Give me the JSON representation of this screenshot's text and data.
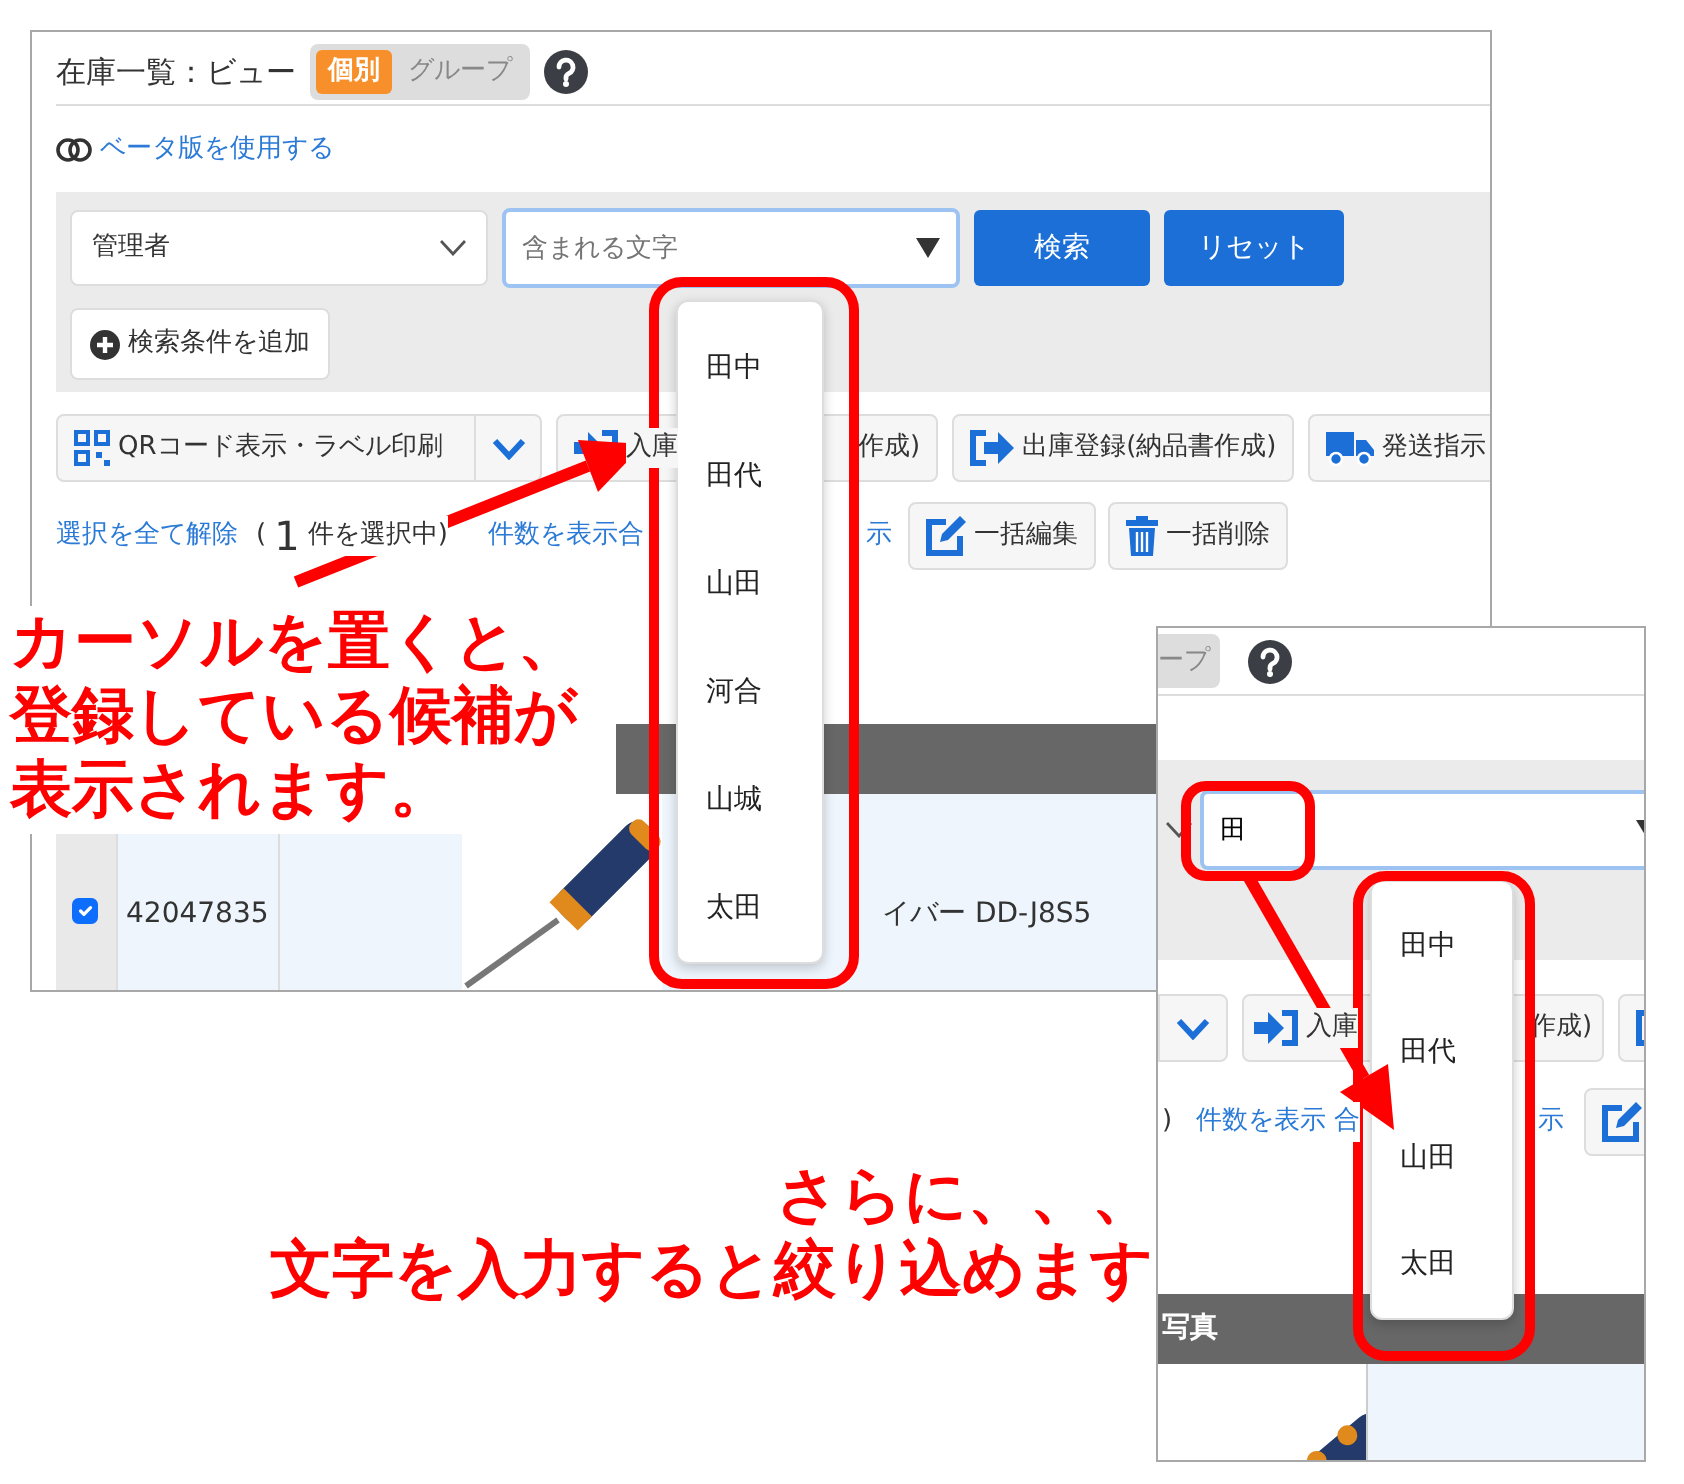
{
  "screen_1": {
    "title": "在庫一覧：ビュー",
    "view_toggle": [
      {
        "label": "個別",
        "selected": true
      },
      {
        "label": "グループ",
        "selected": false
      }
    ],
    "beta_link": "ベータ版を使用する",
    "filter": {
      "field_select": "管理者",
      "search": {
        "placeholder": "含まれる文字"
      },
      "buttons": [
        "検索",
        "リセット"
      ],
      "add_condition": "検索条件を追加"
    },
    "toolbar": [
      {
        "kind": "split",
        "label": "QRコード表示・ラベル印刷"
      },
      {
        "kind": "button",
        "label": "入庫",
        "label_tail": "作成)"
      },
      {
        "kind": "button",
        "label": "出庫登録(納品書作成)"
      },
      {
        "kind": "button",
        "label": "発送指示"
      },
      {
        "kind": "stub"
      }
    ],
    "selection": {
      "clear_link": "選択を全て解除",
      "open_paren": "(",
      "count": "1",
      "count_suffix": "件を選択中)",
      "count_link": "件数を表示合",
      "count_link_tail": "示"
    },
    "bulk_buttons": [
      "一括編集",
      "一括削除"
    ],
    "table_row": {
      "checked": true,
      "id": "42047835",
      "name": "イバー DD-J8S5"
    },
    "suggestions": [
      "田中",
      "田代",
      "山田",
      "河合",
      "山城",
      "太田"
    ]
  },
  "annotation_1": {
    "lines": [
      "カーソルを置くと、",
      "登録している候補が",
      "表示されます。"
    ]
  },
  "screen_2": {
    "toggle_fragment": "ープ",
    "search": {
      "value": "田"
    },
    "toolbar": [
      {
        "kind": "split_tail"
      },
      {
        "kind": "button",
        "label": "入庫",
        "label_tail": "作成)"
      },
      {
        "kind": "stub"
      }
    ],
    "selection": {
      "close_paren": ")",
      "count_link": "件数を表示 合",
      "count_link_tail": "示"
    },
    "table": {
      "columns": [
        "写真"
      ]
    },
    "suggestions": [
      "田中",
      "田代",
      "山田",
      "太田"
    ]
  },
  "annotation_2": {
    "lines": [
      "さらに、、、",
      "文字を入力すると絞り込めます"
    ]
  }
}
